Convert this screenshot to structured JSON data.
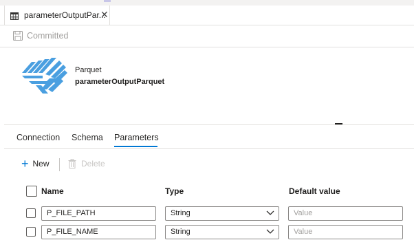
{
  "tab": {
    "title": "parameterOutputPar...",
    "close_glyph": "✕"
  },
  "toolbar": {
    "committed_label": "Committed"
  },
  "dataset": {
    "format": "Parquet",
    "name": "parameterOutputParquet"
  },
  "subtabs": [
    {
      "label": "Connection",
      "active": false
    },
    {
      "label": "Schema",
      "active": false
    },
    {
      "label": "Parameters",
      "active": true
    }
  ],
  "actions": {
    "new_label": "New",
    "delete_label": "Delete"
  },
  "grid": {
    "headers": {
      "name": "Name",
      "type": "Type",
      "default": "Default value"
    },
    "rows": [
      {
        "name": "P_FILE_PATH",
        "type": "String",
        "default_placeholder": "Value"
      },
      {
        "name": "P_FILE_NAME",
        "type": "String",
        "default_placeholder": "Value"
      }
    ]
  },
  "colors": {
    "accent": "#0078d4",
    "logo": "#4a9fe0",
    "border": "#8a8886"
  },
  "icons": [
    "table-icon",
    "close-icon",
    "save-icon",
    "parquet-logo",
    "plus-icon",
    "trash-icon",
    "chevron-down-icon",
    "checkbox"
  ]
}
